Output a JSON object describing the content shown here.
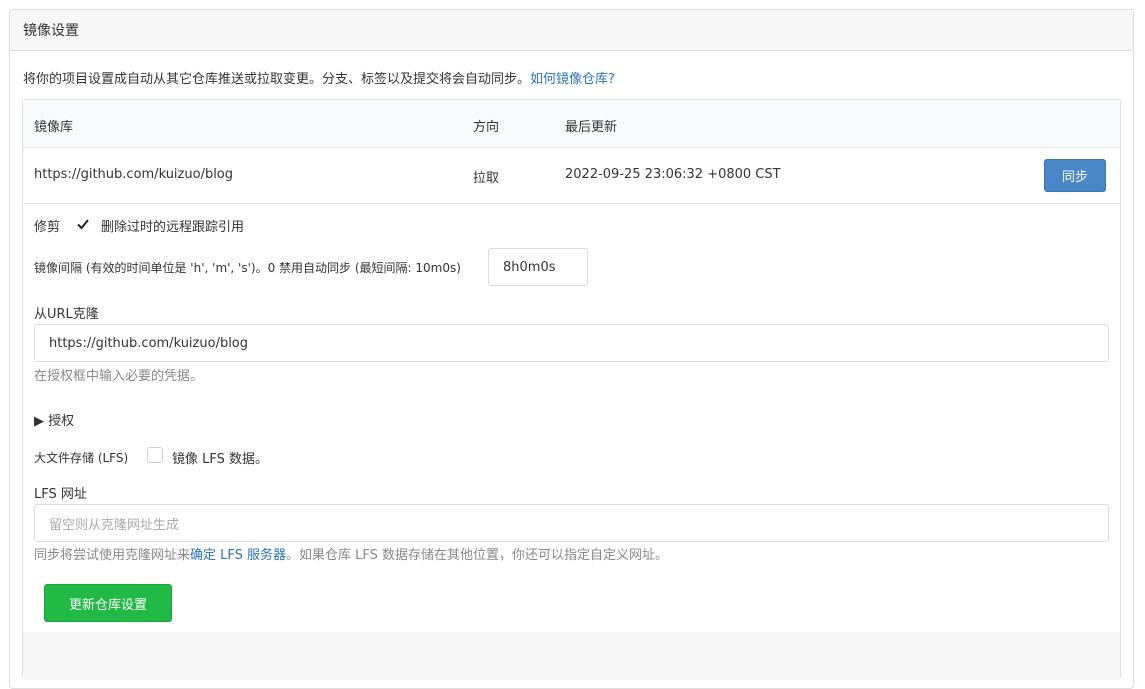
{
  "panel": {
    "title": "镜像设置"
  },
  "description": {
    "text": "将你的项目设置成自动从其它仓库推送或拉取变更。分支、标签以及提交将会自动同步。",
    "link": "如何镜像仓库?"
  },
  "table": {
    "headers": [
      "镜像库",
      "方向",
      "最后更新"
    ],
    "row": {
      "url": "https://github.com/kuizuo/blog",
      "direction": "拉取",
      "updated": "2022-09-25 23:06:32 +0800 CST",
      "sync_label": "同步"
    }
  },
  "form": {
    "prune_label": "修剪",
    "prune_checked": true,
    "prune_desc": "删除过时的远程跟踪引用",
    "interval_label": "镜像间隔 (有效的时间单位是 'h', 'm', 's')。0 禁用自动同步 (最短间隔: 10m0s)",
    "interval_value": "8h0m0s",
    "clone_url_label": "从URL克隆",
    "clone_url_value": "https://github.com/kuizuo/blog",
    "clone_url_help": "在授权框中输入必要的凭据。",
    "auth_toggle": "▶ 授权",
    "lfs_label": "大文件存储 (LFS)",
    "lfs_checked": false,
    "lfs_desc": "镜像 LFS 数据。",
    "lfs_url_label": "LFS 网址",
    "lfs_url_placeholder": "留空则从克隆网址生成",
    "lfs_help_prefix": "同步将尝试使用克隆网址来",
    "lfs_help_link": "确定 LFS 服务器",
    "lfs_help_suffix": "。如果仓库 LFS 数据存储在其他位置，你还可以指定自定义网址。",
    "submit_label": "更新仓库设置"
  },
  "colors": {
    "primary": "#4a87c8",
    "success": "#21ba45",
    "link": "#2a74b8"
  }
}
